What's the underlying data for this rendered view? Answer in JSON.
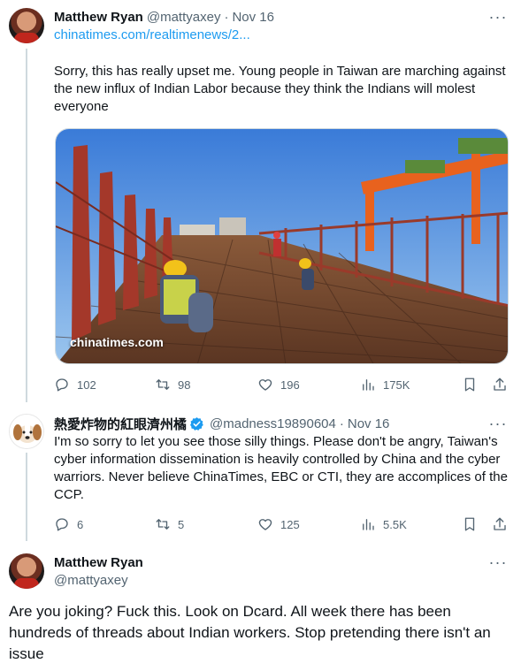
{
  "tweet1": {
    "name": "Matthew Ryan",
    "handle": "@mattyaxey",
    "separator": "·",
    "date": "Nov 16",
    "link": "chinatimes.com/realtimenews/2...",
    "text": "Sorry, this has really upset me. Young people in Taiwan are marching against the new influx of Indian Labor because they think the Indians will molest everyone",
    "image_watermark": "chinatimes.com",
    "stats": {
      "replies": "102",
      "retweets": "98",
      "likes": "196",
      "views": "175K"
    },
    "more": "···"
  },
  "tweet2": {
    "name": "熱愛炸物的紅眼濟州橘",
    "handle": "@madness19890604",
    "separator": "·",
    "date": "Nov 16",
    "text": "I'm so sorry to let you see those silly things. Please don't be angry, Taiwan's cyber information dissemination is heavily controlled by China and the cyber warriors. Never believe ChinaTimes, EBC or CTI, they are accomplices of the CCP.",
    "stats": {
      "replies": "6",
      "retweets": "5",
      "likes": "125",
      "views": "5.5K"
    },
    "more": "···"
  },
  "tweet3": {
    "name": "Matthew Ryan",
    "handle": "@mattyaxey",
    "text": "Are you joking? Fuck this. Look on Dcard. All week there has been hundreds of threads about Indian workers. Stop pretending there isn't an issue",
    "more": "···"
  },
  "colors": {
    "accent": "#1d9bf0",
    "secondary_text": "#536471",
    "verified": "#1d9bf0"
  }
}
